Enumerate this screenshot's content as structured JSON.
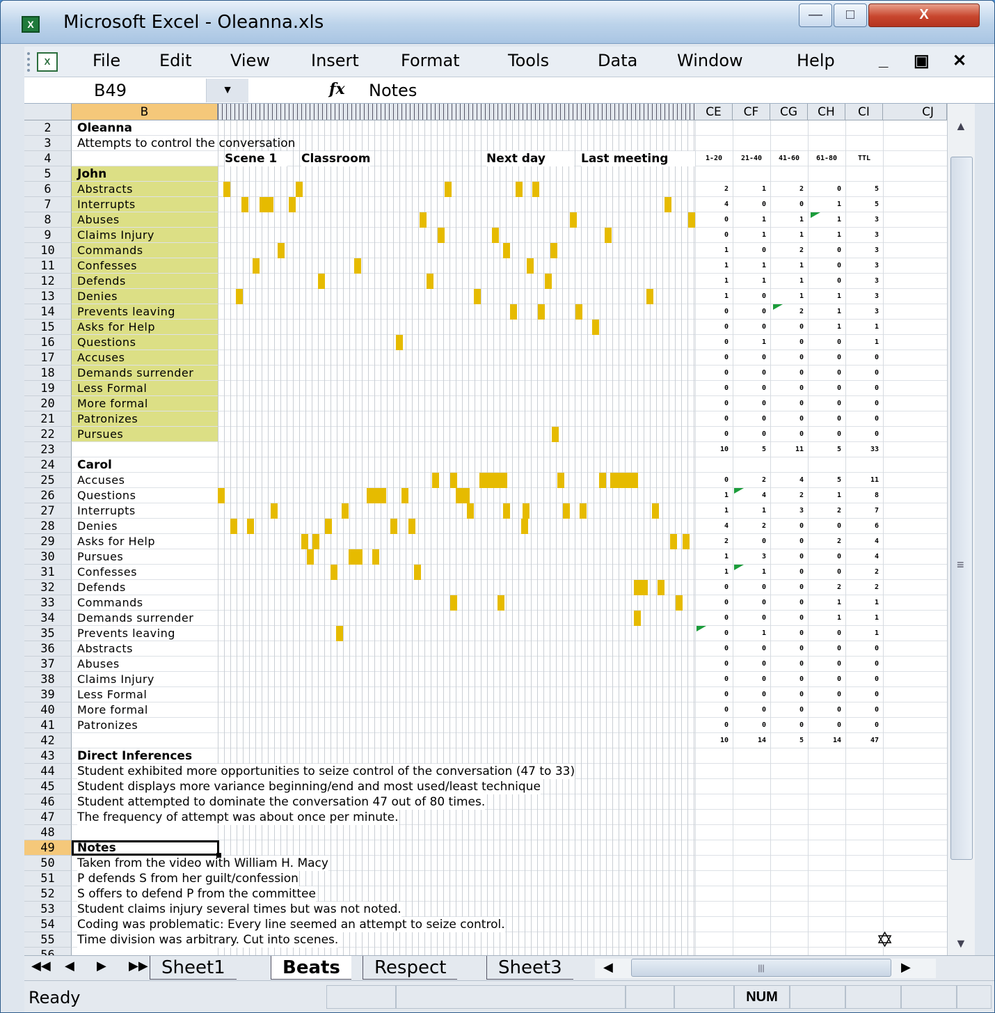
{
  "window": {
    "title": "Microsoft Excel - Oleanna.xls",
    "min": "—",
    "max": "□",
    "close": "X"
  },
  "menu": {
    "items": [
      "File",
      "Edit",
      "View",
      "Insert",
      "Format",
      "Tools",
      "Data",
      "Window",
      "Help"
    ],
    "doc_min": "_",
    "doc_restore": "▣",
    "doc_close": "✕"
  },
  "formula": {
    "name_box": "B49",
    "fx": "fx",
    "value": "Notes"
  },
  "columns": {
    "b": "B",
    "ce": "CE",
    "cf": "CF",
    "cg": "CG",
    "ch": "CH",
    "ci": "CI",
    "cj": "CJ"
  },
  "row_numbers": [
    "2",
    "3",
    "4",
    "5",
    "6",
    "7",
    "8",
    "9",
    "10",
    "11",
    "12",
    "13",
    "14",
    "15",
    "16",
    "17",
    "18",
    "19",
    "20",
    "21",
    "22",
    "23",
    "24",
    "25",
    "26",
    "27",
    "28",
    "29",
    "30",
    "31",
    "32",
    "33",
    "34",
    "35",
    "36",
    "37",
    "38",
    "39",
    "40",
    "41",
    "42",
    "43",
    "44",
    "45",
    "46",
    "47",
    "48",
    "49",
    "50",
    "51",
    "52",
    "53",
    "54",
    "55",
    "56"
  ],
  "header_cells": {
    "title": "Oleanna",
    "subtitle": "Attempts to control the conversation",
    "scene1": "Scene 1",
    "classroom": "Classroom",
    "next_day": "Next day",
    "last_meeting": "Last meeting",
    "ce4": "1-20",
    "cf4": "21-40",
    "cg4": "41-60",
    "ch4": "61-80",
    "ci4": "TTL"
  },
  "john": {
    "label": "John",
    "behaviors": [
      "Abstracts",
      "Interrupts",
      "Abuses",
      "Claims Injury",
      "Commands",
      "Confesses",
      "Defends",
      "Denies",
      "Prevents leaving",
      "Asks for Help",
      "Questions",
      "Accuses",
      "Demands surrender",
      "Less Formal",
      "More formal",
      "Patronizes",
      "Pursues"
    ],
    "counts": [
      [
        "2",
        "1",
        "2",
        "0",
        "5"
      ],
      [
        "4",
        "0",
        "0",
        "1",
        "5"
      ],
      [
        "0",
        "1",
        "1",
        "1",
        "3"
      ],
      [
        "0",
        "1",
        "1",
        "1",
        "3"
      ],
      [
        "1",
        "0",
        "2",
        "0",
        "3"
      ],
      [
        "1",
        "1",
        "1",
        "0",
        "3"
      ],
      [
        "1",
        "1",
        "1",
        "0",
        "3"
      ],
      [
        "1",
        "0",
        "1",
        "1",
        "3"
      ],
      [
        "0",
        "0",
        "2",
        "1",
        "3"
      ],
      [
        "0",
        "0",
        "0",
        "1",
        "1"
      ],
      [
        "0",
        "1",
        "0",
        "0",
        "1"
      ],
      [
        "0",
        "0",
        "0",
        "0",
        "0"
      ],
      [
        "0",
        "0",
        "0",
        "0",
        "0"
      ],
      [
        "0",
        "0",
        "0",
        "0",
        "0"
      ],
      [
        "0",
        "0",
        "0",
        "0",
        "0"
      ],
      [
        "0",
        "0",
        "0",
        "0",
        "0"
      ],
      [
        "0",
        "0",
        "0",
        "0",
        "0"
      ]
    ],
    "totals": [
      "10",
      "5",
      "11",
      "5",
      "33"
    ]
  },
  "carol": {
    "label": "Carol",
    "behaviors": [
      "Accuses",
      "Questions",
      "Interrupts",
      "Denies",
      "Asks for Help",
      "Pursues",
      "Confesses",
      "Defends",
      "Commands",
      "Demands surrender",
      "Prevents leaving",
      "Abstracts",
      "Abuses",
      "Claims Injury",
      "Less Formal",
      "More formal",
      "Patronizes"
    ],
    "counts": [
      [
        "0",
        "2",
        "4",
        "5",
        "11"
      ],
      [
        "1",
        "4",
        "2",
        "1",
        "8"
      ],
      [
        "1",
        "1",
        "3",
        "2",
        "7"
      ],
      [
        "4",
        "2",
        "0",
        "0",
        "6"
      ],
      [
        "2",
        "0",
        "0",
        "2",
        "4"
      ],
      [
        "1",
        "3",
        "0",
        "0",
        "4"
      ],
      [
        "1",
        "1",
        "0",
        "0",
        "2"
      ],
      [
        "0",
        "0",
        "0",
        "2",
        "2"
      ],
      [
        "0",
        "0",
        "0",
        "1",
        "1"
      ],
      [
        "0",
        "0",
        "0",
        "1",
        "1"
      ],
      [
        "0",
        "1",
        "0",
        "0",
        "1"
      ],
      [
        "0",
        "0",
        "0",
        "0",
        "0"
      ],
      [
        "0",
        "0",
        "0",
        "0",
        "0"
      ],
      [
        "0",
        "0",
        "0",
        "0",
        "0"
      ],
      [
        "0",
        "0",
        "0",
        "0",
        "0"
      ],
      [
        "0",
        "0",
        "0",
        "0",
        "0"
      ],
      [
        "0",
        "0",
        "0",
        "0",
        "0"
      ]
    ],
    "totals": [
      "10",
      "14",
      "5",
      "14",
      "47"
    ]
  },
  "inferences": {
    "heading": "Direct Inferences",
    "lines": [
      "Student exhibited more opportunities to seize control of the conversation (47 to 33)",
      "Student displays more variance beginning/end and most used/least technique",
      "Student attempted to dominate the conversation 47 out of 80 times.",
      "The frequency of attempt was about once per minute."
    ]
  },
  "notes": {
    "heading": "Notes",
    "lines": [
      "Taken from the video with William H. Macy",
      "P defends S from her guilt/confession",
      "S offers to defend P from the committee",
      "Student claims injury several times but was not noted.",
      "Coding was problematic: Every line seemed an attempt to seize control.",
      "Time division was arbitrary.  Cut into scenes."
    ]
  },
  "tabs": [
    "Sheet1",
    "Beats",
    "Respect",
    "Sheet3"
  ],
  "status": {
    "text": "Ready",
    "num": "NUM"
  },
  "colors": {
    "highlight": "#e6bb00",
    "label_shade": "#dcdf85",
    "selected_header": "#f5c87a"
  }
}
